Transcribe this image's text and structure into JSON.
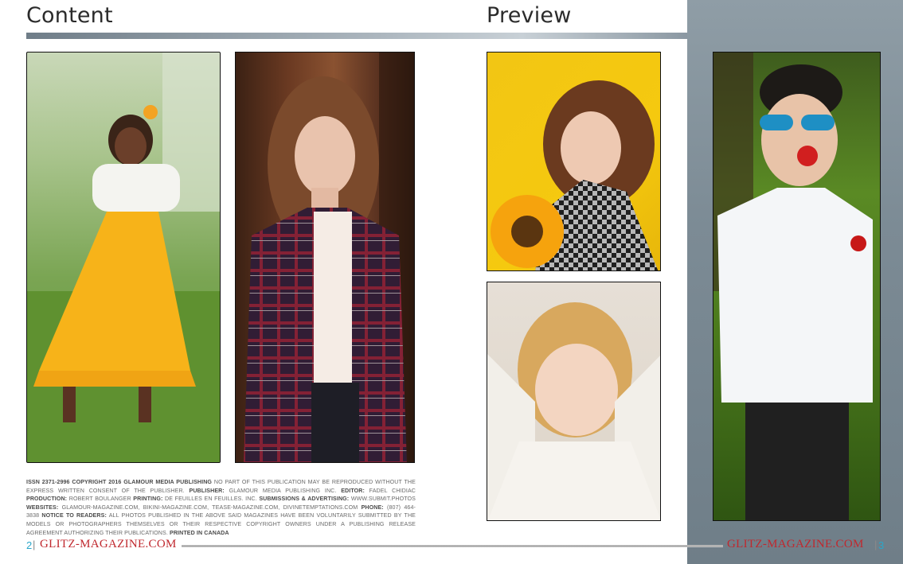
{
  "titles": {
    "content": "Content",
    "preview": "Preview"
  },
  "photos": [
    {
      "name": "girl-yellow-dress-photo"
    },
    {
      "name": "girl-plaid-shirt-photo"
    },
    {
      "name": "girl-sunflower-photo"
    },
    {
      "name": "blonde-girl-sweater-photo"
    },
    {
      "name": "boy-rose-sunglasses-photo"
    }
  ],
  "colophon": {
    "issn_label": "ISSN 2371-2996 COPYRIGHT 2016 GLAMOUR MEDIA PUBLISHING",
    "copyright_text": " NO PART OF THIS PUBLICATION MAY BE REPRODUCED WITHOUT THE EXPRESS WRITTEN CONSENT OF THE PUBLISHER. ",
    "publisher_label": "PUBLISHER:",
    "publisher_text": " GLAMOUR MEDIA PUBLISHING INC. ",
    "editor_label": "EDITOR:",
    "editor_text": " FADEL CHIDIAC ",
    "production_label": "PRODUCTION:",
    "production_text": " ROBERT BOULANGER ",
    "printing_label": "PRINTING:",
    "printing_text": " DE FEUILLES EN FEUILLES. INC. ",
    "submissions_label": "SUBMISSIONS & ADVERTISING:",
    "submissions_text": " WWW.SUBMIT.PHOTOS ",
    "websites_label": "WEBSITES:",
    "websites_text": " GLAMOUR-MAGAZINE.COM, BIKINI-MAGAZINE.COM, TEASE-MAGAZINE.COM, DIVINETEMPTATIONS.COM ",
    "phone_label": "PHONE:",
    "phone_text": " (807) 464-3838 ",
    "notice_label": "NOTICE TO READERS:",
    "notice_text": " ALL PHOTOS PUBLISHED IN THE ABOVE SAID MAGAZINES HAVE BEEN VOLUNTARILY SUBMITTED BY THE MODELS OR PHOTOGRAPHERS THEMSELVES OR THEIR RESPECTIVE COPYRIGHT OWNERS UNDER A PUBLISHING RELEASE AGREEMENT AUTHORIZING THEIR PUBLICATIONS. ",
    "printed_label": "PRINTED IN CANADA"
  },
  "footer": {
    "left_page": "2",
    "left_sep": "|",
    "left_brand": "GLITZ-MAGAZINE.COM",
    "right_brand": "GLITZ-MAGAZINE.COM",
    "right_sep": "|",
    "right_page": "3"
  },
  "colors": {
    "accent": "#2aa6c9",
    "brand": "#c0282e",
    "panel": "#7c8b95"
  }
}
